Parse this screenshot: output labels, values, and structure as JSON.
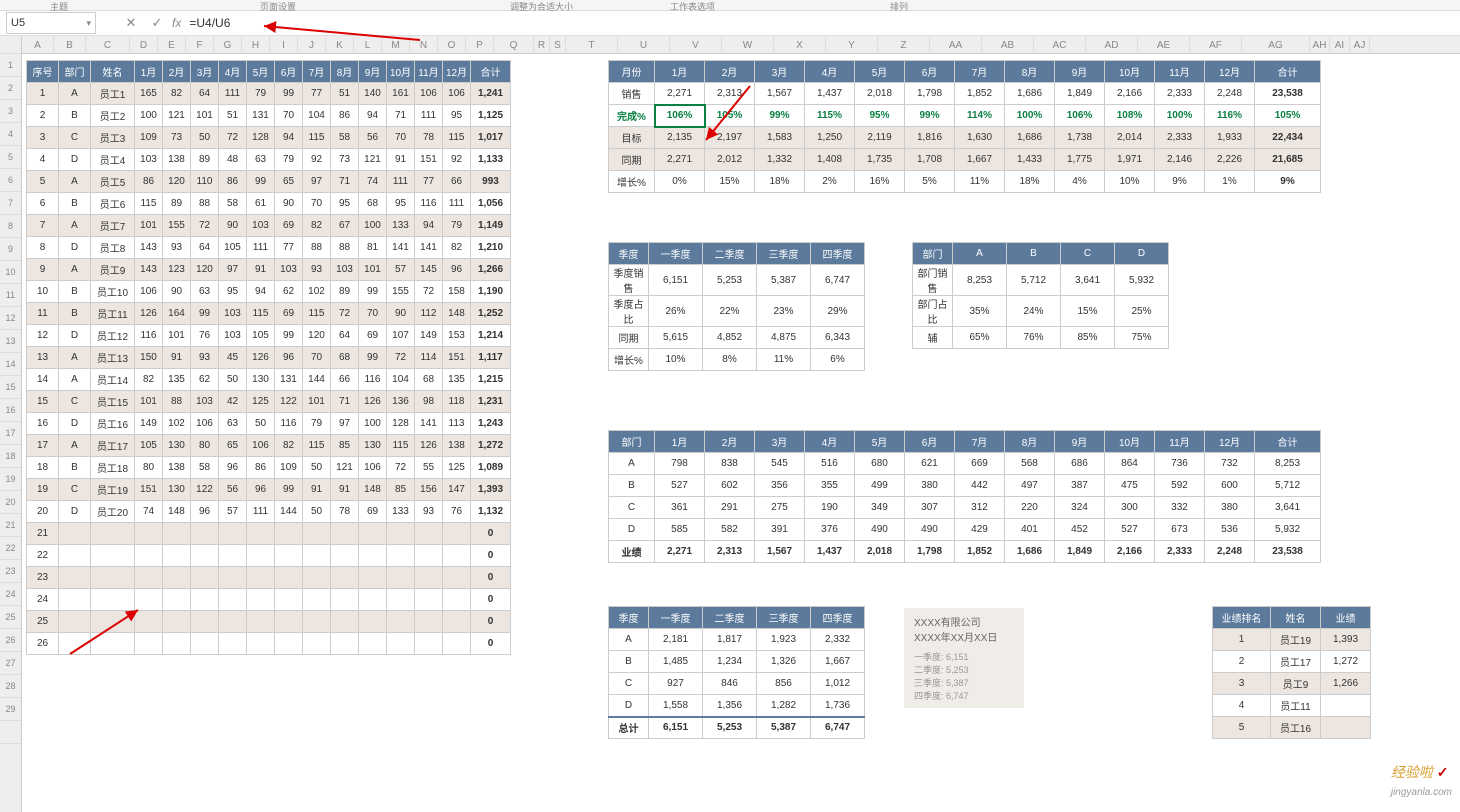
{
  "ribbon": {
    "g1": "主题",
    "g2": "页面设置",
    "g3": "调整为合适大小",
    "g4": "工作表选项",
    "g5": "排列"
  },
  "namebox": "U5",
  "formula": "=U4/U6",
  "cols": [
    "A",
    "B",
    "C",
    "D",
    "E",
    "F",
    "G",
    "H",
    "I",
    "J",
    "K",
    "L",
    "M",
    "N",
    "O",
    "P",
    "Q",
    "R",
    "S",
    "T",
    "U",
    "V",
    "W",
    "X",
    "Y",
    "Z",
    "AA",
    "AB",
    "AC",
    "AD",
    "AE",
    "AF",
    "AG",
    "AH",
    "AI",
    "AJ"
  ],
  "emp": {
    "headers": [
      "序号",
      "部门",
      "姓名",
      "1月",
      "2月",
      "3月",
      "4月",
      "5月",
      "6月",
      "7月",
      "8月",
      "9月",
      "10月",
      "11月",
      "12月",
      "合计"
    ],
    "rows": [
      [
        "1",
        "A",
        "员工1",
        "165",
        "82",
        "64",
        "111",
        "79",
        "99",
        "77",
        "51",
        "140",
        "161",
        "106",
        "106",
        "1,241"
      ],
      [
        "2",
        "B",
        "员工2",
        "100",
        "121",
        "101",
        "51",
        "131",
        "70",
        "104",
        "86",
        "94",
        "71",
        "111",
        "95",
        "1,125"
      ],
      [
        "3",
        "C",
        "员工3",
        "109",
        "73",
        "50",
        "72",
        "128",
        "94",
        "115",
        "58",
        "56",
        "70",
        "78",
        "115",
        "1,017"
      ],
      [
        "4",
        "D",
        "员工4",
        "103",
        "138",
        "89",
        "48",
        "63",
        "79",
        "92",
        "73",
        "121",
        "91",
        "151",
        "92",
        "1,133"
      ],
      [
        "5",
        "A",
        "员工5",
        "86",
        "120",
        "110",
        "86",
        "99",
        "65",
        "97",
        "71",
        "74",
        "111",
        "77",
        "66",
        "993"
      ],
      [
        "6",
        "B",
        "员工6",
        "115",
        "89",
        "88",
        "58",
        "61",
        "90",
        "70",
        "95",
        "68",
        "95",
        "116",
        "111",
        "1,056"
      ],
      [
        "7",
        "A",
        "员工7",
        "101",
        "155",
        "72",
        "90",
        "103",
        "69",
        "82",
        "67",
        "100",
        "133",
        "94",
        "79",
        "1,149"
      ],
      [
        "8",
        "D",
        "员工8",
        "143",
        "93",
        "64",
        "105",
        "111",
        "77",
        "88",
        "88",
        "81",
        "141",
        "141",
        "82",
        "1,210"
      ],
      [
        "9",
        "A",
        "员工9",
        "143",
        "123",
        "120",
        "97",
        "91",
        "103",
        "93",
        "103",
        "101",
        "57",
        "145",
        "96",
        "1,266"
      ],
      [
        "10",
        "B",
        "员工10",
        "106",
        "90",
        "63",
        "95",
        "94",
        "62",
        "102",
        "89",
        "99",
        "155",
        "72",
        "158",
        "1,190"
      ],
      [
        "11",
        "B",
        "员工11",
        "126",
        "164",
        "99",
        "103",
        "115",
        "69",
        "115",
        "72",
        "70",
        "90",
        "112",
        "148",
        "1,252"
      ],
      [
        "12",
        "D",
        "员工12",
        "116",
        "101",
        "76",
        "103",
        "105",
        "99",
        "120",
        "64",
        "69",
        "107",
        "149",
        "153",
        "1,214"
      ],
      [
        "13",
        "A",
        "员工13",
        "150",
        "91",
        "93",
        "45",
        "126",
        "96",
        "70",
        "68",
        "99",
        "72",
        "114",
        "151",
        "1,117"
      ],
      [
        "14",
        "A",
        "员工14",
        "82",
        "135",
        "62",
        "50",
        "130",
        "131",
        "144",
        "66",
        "116",
        "104",
        "68",
        "135",
        "1,215"
      ],
      [
        "15",
        "C",
        "员工15",
        "101",
        "88",
        "103",
        "42",
        "125",
        "122",
        "101",
        "71",
        "126",
        "136",
        "98",
        "118",
        "1,231"
      ],
      [
        "16",
        "D",
        "员工16",
        "149",
        "102",
        "106",
        "63",
        "50",
        "116",
        "79",
        "97",
        "100",
        "128",
        "141",
        "113",
        "1,243"
      ],
      [
        "17",
        "A",
        "员工17",
        "105",
        "130",
        "80",
        "65",
        "106",
        "82",
        "115",
        "85",
        "130",
        "115",
        "126",
        "138",
        "1,272"
      ],
      [
        "18",
        "B",
        "员工18",
        "80",
        "138",
        "58",
        "96",
        "86",
        "109",
        "50",
        "121",
        "106",
        "72",
        "55",
        "125",
        "1,089"
      ],
      [
        "19",
        "C",
        "员工19",
        "151",
        "130",
        "122",
        "56",
        "96",
        "99",
        "91",
        "91",
        "148",
        "85",
        "156",
        "147",
        "1,393"
      ],
      [
        "20",
        "D",
        "员工20",
        "74",
        "148",
        "96",
        "57",
        "111",
        "144",
        "50",
        "78",
        "69",
        "133",
        "93",
        "76",
        "1,132"
      ]
    ],
    "zeros": [
      "21",
      "22",
      "23",
      "24",
      "25",
      "26"
    ]
  },
  "month": {
    "hdr": [
      "月份",
      "1月",
      "2月",
      "3月",
      "4月",
      "5月",
      "6月",
      "7月",
      "8月",
      "9月",
      "10月",
      "11月",
      "12月",
      "合计"
    ],
    "sales": [
      "销售",
      "2,271",
      "2,313",
      "1,567",
      "1,437",
      "2,018",
      "1,798",
      "1,852",
      "1,686",
      "1,849",
      "2,166",
      "2,333",
      "2,248",
      "23,538"
    ],
    "comp": [
      "完成%",
      "106%",
      "105%",
      "99%",
      "115%",
      "95%",
      "99%",
      "114%",
      "100%",
      "106%",
      "108%",
      "100%",
      "116%",
      "105%"
    ],
    "target": [
      "目标",
      "2,135",
      "2,197",
      "1,583",
      "1,250",
      "2,119",
      "1,816",
      "1,630",
      "1,686",
      "1,738",
      "2,014",
      "2,333",
      "1,933",
      "22,434"
    ],
    "same": [
      "同期",
      "2,271",
      "2,012",
      "1,332",
      "1,408",
      "1,735",
      "1,708",
      "1,667",
      "1,433",
      "1,775",
      "1,971",
      "2,146",
      "2,226",
      "21,685"
    ],
    "grow": [
      "增长%",
      "0%",
      "15%",
      "18%",
      "2%",
      "16%",
      "5%",
      "11%",
      "18%",
      "4%",
      "10%",
      "9%",
      "1%",
      "9%"
    ]
  },
  "q1": {
    "hdr": [
      "季度",
      "一季度",
      "二季度",
      "三季度",
      "四季度"
    ],
    "r1": [
      "季度销售",
      "6,151",
      "5,253",
      "5,387",
      "6,747"
    ],
    "r2": [
      "季度占比",
      "26%",
      "22%",
      "23%",
      "29%"
    ],
    "r3": [
      "同期",
      "5,615",
      "4,852",
      "4,875",
      "6,343"
    ],
    "r4": [
      "增长%",
      "10%",
      "8%",
      "11%",
      "6%"
    ]
  },
  "dept1": {
    "hdr": [
      "部门",
      "A",
      "B",
      "C",
      "D"
    ],
    "r1": [
      "部门销售",
      "8,253",
      "5,712",
      "3,641",
      "5,932"
    ],
    "r2": [
      "部门占比",
      "35%",
      "24%",
      "15%",
      "25%"
    ],
    "r3": [
      "辅",
      "65%",
      "76%",
      "85%",
      "75%"
    ]
  },
  "dept2": {
    "hdr": [
      "部门",
      "1月",
      "2月",
      "3月",
      "4月",
      "5月",
      "6月",
      "7月",
      "8月",
      "9月",
      "10月",
      "11月",
      "12月",
      "合计"
    ],
    "rows": [
      [
        "A",
        "798",
        "838",
        "545",
        "516",
        "680",
        "621",
        "669",
        "568",
        "686",
        "864",
        "736",
        "732",
        "8,253"
      ],
      [
        "B",
        "527",
        "602",
        "356",
        "355",
        "499",
        "380",
        "442",
        "497",
        "387",
        "475",
        "592",
        "600",
        "5,712"
      ],
      [
        "C",
        "361",
        "291",
        "275",
        "190",
        "349",
        "307",
        "312",
        "220",
        "324",
        "300",
        "332",
        "380",
        "3,641"
      ],
      [
        "D",
        "585",
        "582",
        "391",
        "376",
        "490",
        "490",
        "429",
        "401",
        "452",
        "527",
        "673",
        "536",
        "5,932"
      ],
      [
        "业绩",
        "2,271",
        "2,313",
        "1,567",
        "1,437",
        "2,018",
        "1,798",
        "1,852",
        "1,686",
        "1,849",
        "2,166",
        "2,333",
        "2,248",
        "23,538"
      ]
    ]
  },
  "q2": {
    "hdr": [
      "季度",
      "一季度",
      "二季度",
      "三季度",
      "四季度"
    ],
    "rows": [
      [
        "A",
        "2,181",
        "1,817",
        "1,923",
        "2,332"
      ],
      [
        "B",
        "1,485",
        "1,234",
        "1,326",
        "1,667"
      ],
      [
        "C",
        "927",
        "846",
        "856",
        "1,012"
      ],
      [
        "D",
        "1,558",
        "1,356",
        "1,282",
        "1,736"
      ],
      [
        "总计",
        "6,151",
        "5,253",
        "5,387",
        "6,747"
      ]
    ]
  },
  "info": {
    "l1": "XXXX有限公司",
    "l2": "XXXX年XX月XX日",
    "l3": "一季度: 6,151",
    "l4": "二季度: 5,253",
    "l5": "三季度: 5,387",
    "l6": "四季度: 6,747"
  },
  "rank": {
    "hdr": [
      "业绩排名",
      "姓名",
      "业绩"
    ],
    "rows": [
      [
        "1",
        "员工19",
        "1,393"
      ],
      [
        "2",
        "员工17",
        "1,272"
      ],
      [
        "3",
        "员工9",
        "1,266"
      ],
      [
        "4",
        "员工11",
        ""
      ],
      [
        "5",
        "员工16",
        ""
      ]
    ]
  },
  "watermark": "jingyanla.com"
}
